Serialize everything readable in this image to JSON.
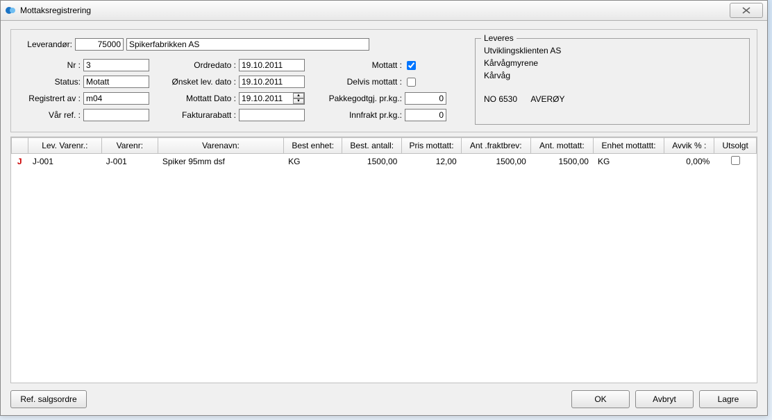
{
  "window": {
    "title": "Mottaksregistrering"
  },
  "supplier": {
    "label": "Leverandør:",
    "code": "75000",
    "name": "Spikerfabrikken AS"
  },
  "labels": {
    "nr": "Nr :",
    "status": "Status:",
    "reg_by": "Registrert av :",
    "our_ref": "Vår ref. :",
    "order_date": "Ordredato :",
    "wanted_date": "Ønsket lev. dato :",
    "received_date": "Mottatt Dato :",
    "invoice_discount": "Fakturarabatt :",
    "received": "Mottatt :",
    "partial": "Delvis mottatt :",
    "package_per_kg": "Pakkegodtgj. pr.kg.:",
    "freight_per_kg": "Innfrakt pr.kg.:"
  },
  "values": {
    "nr": "3",
    "status": "Motatt",
    "reg_by": "m04",
    "our_ref": "",
    "order_date": "19.10.2011",
    "wanted_date": "19.10.2011",
    "received_date": "19.10.2011",
    "invoice_discount": "",
    "received_checked": true,
    "partial_checked": false,
    "package_per_kg": "0",
    "freight_per_kg": "0"
  },
  "delivery": {
    "legend": "Leveres",
    "lines": [
      "Utviklingsklienten AS",
      "Kårvågmyrene",
      "Kårvåg"
    ],
    "postal": "NO 6530",
    "city": "AVERØY"
  },
  "grid": {
    "headers": {
      "lev_varenr": "Lev. Varenr.:",
      "varenr": "Varenr:",
      "varenavn": "Varenavn:",
      "best_enhet": "Best enhet:",
      "best_antall": "Best. antall:",
      "pris_mottatt": "Pris mottatt:",
      "ant_fraktbrev": "Ant .fraktbrev:",
      "ant_mottatt": "Ant. mottatt:",
      "enhet_mottatt": "Enhet mottattt:",
      "avvik": "Avvik % :",
      "utsolgt": "Utsolgt"
    },
    "rows": [
      {
        "marker": "J",
        "lev_varenr": "J-001",
        "varenr": "J-001",
        "varenavn": "Spiker 95mm dsf",
        "best_enhet": "KG",
        "best_antall": "1500,00",
        "pris_mottatt": "12,00",
        "ant_fraktbrev": "1500,00",
        "ant_mottatt": "1500,00",
        "enhet_mottatt": "KG",
        "avvik": "0,00%",
        "utsolgt": false
      }
    ]
  },
  "buttons": {
    "ref_salgsordre": "Ref. salgsordre",
    "ok": "OK",
    "cancel": "Avbryt",
    "save": "Lagre"
  }
}
